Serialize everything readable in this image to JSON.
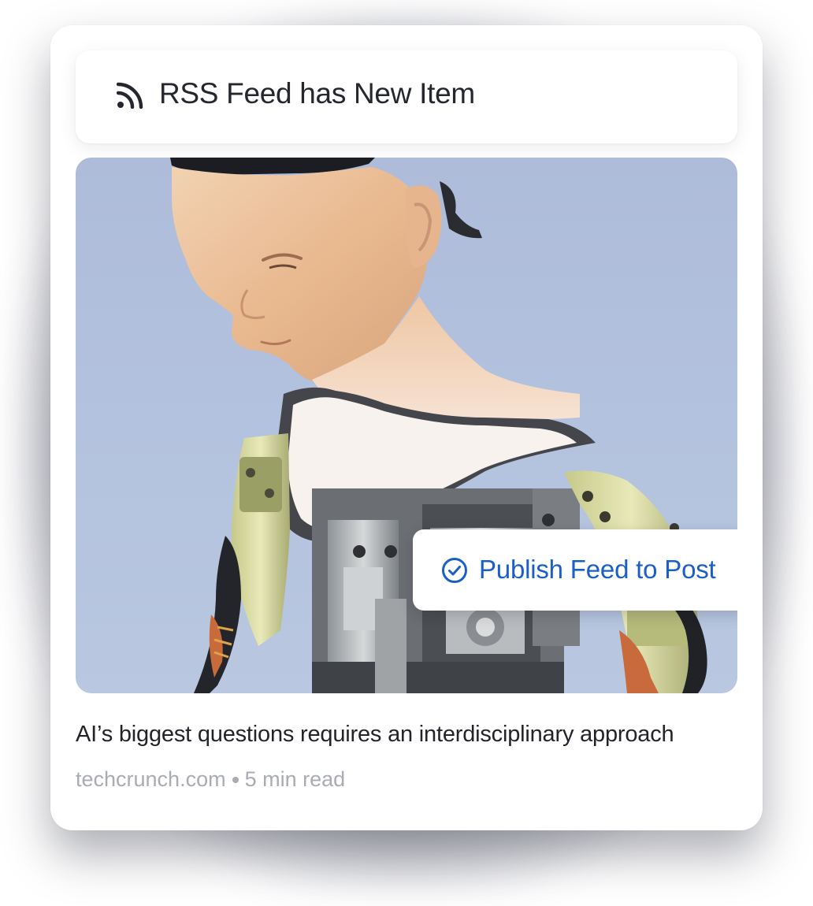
{
  "trigger": {
    "icon": "rss-icon",
    "title": "RSS Feed has New Item"
  },
  "article": {
    "image": "robot-photo",
    "action": {
      "icon": "check-circle-icon",
      "label": "Publish Feed to Post"
    },
    "headline": "AI’s biggest questions requires an interdisciplinary approach",
    "source": "techcrunch.com",
    "read_time": "5 min read"
  },
  "colors": {
    "accent": "#1a5fc8",
    "title_text": "#25272e",
    "meta_text": "#a9acb3",
    "image_background": "#b3c2de"
  }
}
